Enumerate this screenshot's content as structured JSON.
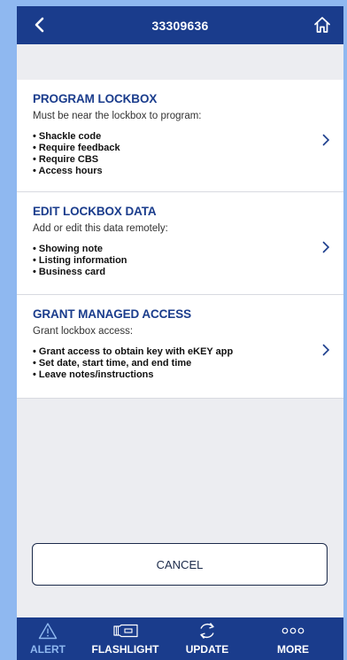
{
  "header": {
    "title": "33309636"
  },
  "cards": [
    {
      "title": "PROGRAM LOCKBOX",
      "subtitle": "Must be near the lockbox to program:",
      "items": [
        "• Shackle code",
        "• Require feedback",
        "• Require CBS",
        "• Access hours"
      ]
    },
    {
      "title": "EDIT LOCKBOX DATA",
      "subtitle": "Add or edit this data remotely:",
      "items": [
        "• Showing note",
        "• Listing information",
        "• Business card"
      ]
    },
    {
      "title": "GRANT MANAGED ACCESS",
      "subtitle": "Grant lockbox access:",
      "items": [
        "• Grant access to obtain key with eKEY app",
        "• Set date, start time, and end time",
        "• Leave notes/instructions"
      ]
    }
  ],
  "cancel_label": "CANCEL",
  "tabs": [
    {
      "label": "ALERT",
      "icon": "warning-icon"
    },
    {
      "label": "FLASHLIGHT",
      "icon": "flashlight-icon"
    },
    {
      "label": "UPDATE",
      "icon": "sync-icon"
    },
    {
      "label": "MORE",
      "icon": "more-icon"
    }
  ],
  "colors": {
    "primary": "#1a3c8c",
    "accent": "#8fb8f0",
    "background": "#ecedf1"
  }
}
